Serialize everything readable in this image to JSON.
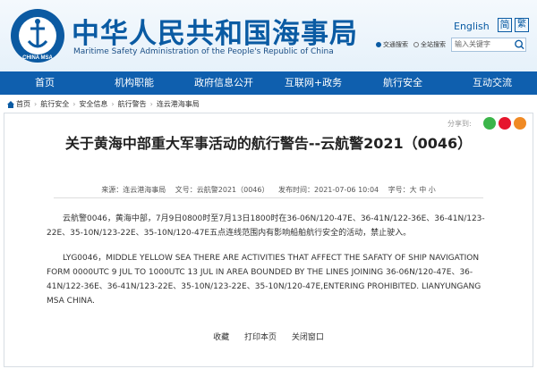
{
  "header": {
    "title_cn": "中华人民共和国海事局",
    "title_en": "Maritime Safety Administration of the People's Republic of China",
    "logo_text": "CHINA MSA",
    "lang_en": "English",
    "lang_cn1": "简",
    "lang_cn2": "繁",
    "radio_site": "交通搜索",
    "radio_all": "全站搜索",
    "search_placeholder": "输入关键字"
  },
  "nav": {
    "items": [
      "首页",
      "机构职能",
      "政府信息公开",
      "互联网+政务",
      "航行安全",
      "互动交流"
    ]
  },
  "breadcrumb": {
    "items": [
      "首页",
      "航行安全",
      "安全信息",
      "航行警告",
      "连云港海事局"
    ]
  },
  "share": {
    "label": "分享到:",
    "colors": [
      "#3bb54a",
      "#e6162d",
      "#f08a24"
    ]
  },
  "article": {
    "title": "关于黄海中部重大军事活动的航行警告--云航警2021（0046）",
    "source": "来源：连云港海事局",
    "doc_no": "文号：云航警2021（0046）",
    "date": "发布时间：2021-07-06 10:04",
    "font_size": "字号：大 中 小",
    "para_cn": "云航警0046，黄海中部，7月9日0800时至7月13日1800时在36-06N/120-47E、36-41N/122-36E、36-41N/123-22E、35-10N/123-22E、35-10N/120-47E五点连线范围内有影响船舶航行安全的活动，禁止驶入。",
    "para_en": "LYG0046，MIDDLE YELLOW SEA THERE ARE ACTIVITIES THAT AFFECT THE SAFATY OF SHIP NAVIGATION FORM 0000UTC 9 JUL TO 1000UTC 13 JUL IN AREA BOUNDED BY THE LINES JOINING 36-06N/120-47E、36-41N/122-36E、36-41N/123-22E、35-10N/123-22E、35-10N/120-47E,ENTERING PROHIBITED. LIANYUNGANG MSA CHINA."
  },
  "actions": {
    "fav": "收藏",
    "print": "打印本页",
    "close": "关闭窗口"
  }
}
